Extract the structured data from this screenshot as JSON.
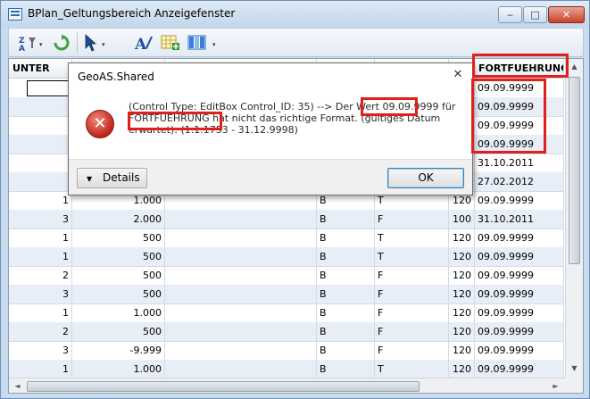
{
  "window": {
    "title": "BPlan_Geltungsbereich Anzeigefenster",
    "minimize_glyph": "‒",
    "maximize_glyph": "□",
    "close_glyph": "✕"
  },
  "toolbar": {
    "icons": [
      "sort-filter-icon",
      "refresh-icon",
      "select-pointer-icon",
      "text-style-icon",
      "add-table-icon",
      "columns-icon"
    ],
    "dropdown_glyph": "▾"
  },
  "grid": {
    "headers": [
      "UNTER",
      "",
      "",
      "",
      "",
      "",
      "FORTFUEHRUNG"
    ],
    "rows": [
      [
        "",
        "",
        "",
        "",
        "",
        "",
        "09.09.9999"
      ],
      [
        "",
        "",
        "",
        "",
        "",
        "",
        "09.09.9999"
      ],
      [
        "",
        "",
        "",
        "",
        "",
        "",
        "09.09.9999"
      ],
      [
        "",
        "",
        "",
        "",
        "",
        "",
        "09.09.9999"
      ],
      [
        "",
        "",
        "",
        "",
        "",
        "",
        "31.10.2011"
      ],
      [
        "",
        "",
        "",
        "",
        "",
        "",
        "27.02.2012"
      ],
      [
        "1",
        "1.000",
        "",
        "B",
        "T",
        "120",
        "09.09.9999"
      ],
      [
        "3",
        "2.000",
        "",
        "B",
        "F",
        "100",
        "31.10.2011"
      ],
      [
        "1",
        "500",
        "",
        "B",
        "T",
        "120",
        "09.09.9999"
      ],
      [
        "1",
        "500",
        "",
        "B",
        "T",
        "120",
        "09.09.9999"
      ],
      [
        "2",
        "500",
        "",
        "B",
        "F",
        "120",
        "09.09.9999"
      ],
      [
        "3",
        "500",
        "",
        "B",
        "F",
        "120",
        "09.09.9999"
      ],
      [
        "1",
        "1.000",
        "",
        "B",
        "F",
        "120",
        "09.09.9999"
      ],
      [
        "2",
        "500",
        "",
        "B",
        "F",
        "120",
        "09.09.9999"
      ],
      [
        "3",
        "-9.999",
        "",
        "B",
        "F",
        "120",
        "09.09.9999"
      ],
      [
        "1",
        "1.000",
        "",
        "B",
        "T",
        "120",
        "09.09.9999"
      ]
    ]
  },
  "dialog": {
    "title": "GeoAS.Shared",
    "close_glyph": "✕",
    "icon": "error-icon",
    "message_lines": [
      "(Control Type: EditBox Control_ID: 35) --> Der Wert 09.09.9999 für",
      "FORTFUEHRUNG hat nicht das richtige Format. (gültiges Datum",
      "erwartet):  (1.1.1753  -  31.12.9998)"
    ],
    "details_label": "Details",
    "details_glyph": "▼",
    "ok_label": "OK"
  },
  "scrollbar": {
    "up": "▲",
    "down": "▼",
    "left": "◄",
    "right": "►"
  },
  "colors": {
    "highlight": "#e0201a",
    "alt_row": "#e7eef7",
    "error_red": "#c0241a"
  }
}
